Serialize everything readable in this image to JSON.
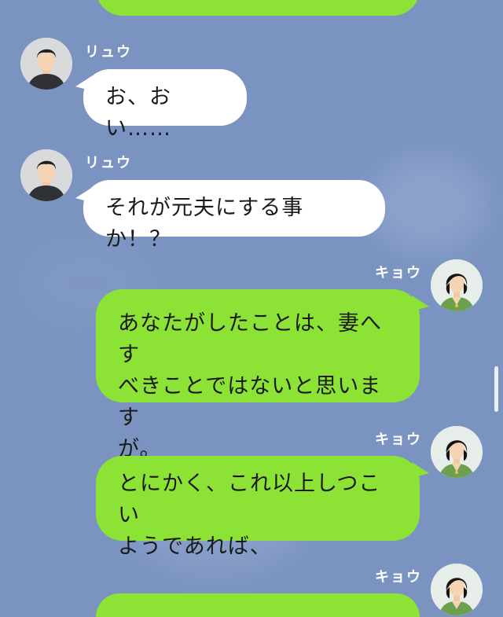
{
  "messages": [
    {
      "sender": "",
      "side": "right",
      "text": ""
    },
    {
      "sender": "リュウ",
      "side": "left",
      "text": "お、おい……"
    },
    {
      "sender": "リュウ",
      "side": "left",
      "text": "それが元夫にする事か！？"
    },
    {
      "sender": "キョウ",
      "side": "right",
      "lines": [
        "あなたがしたことは、妻へす",
        "べきことではないと思います",
        "が。"
      ]
    },
    {
      "sender": "キョウ",
      "side": "right",
      "lines": [
        "とにかく、これ以上しつこい",
        "ようであれば、"
      ]
    },
    {
      "sender": "キョウ",
      "side": "right",
      "text": ""
    }
  ],
  "colors": {
    "background": "#7b93c0",
    "incoming_bubble": "#ffffff",
    "outgoing_bubble": "#8de236"
  },
  "icons": {
    "ryu_avatar": "man-avatar-icon",
    "kyo_avatar": "woman-avatar-icon"
  }
}
